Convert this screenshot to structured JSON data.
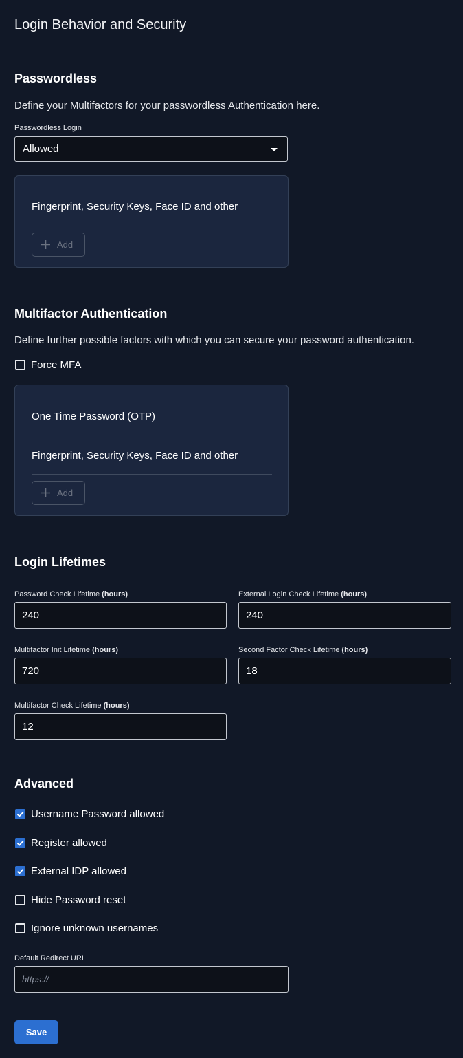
{
  "page": {
    "title": "Login Behavior and Security"
  },
  "passwordless": {
    "title": "Passwordless",
    "description": "Define your Multifactors for your passwordless Authentication here.",
    "select_label": "Passwordless Login",
    "select_value": "Allowed",
    "factors": [
      "Fingerprint, Security Keys, Face ID and other"
    ],
    "add_label": "Add"
  },
  "mfa": {
    "title": "Multifactor Authentication",
    "description": "Define further possible factors with which you can secure your password authentication.",
    "force_mfa_label": "Force MFA",
    "force_mfa_checked": false,
    "factors": [
      "One Time Password (OTP)",
      "Fingerprint, Security Keys, Face ID and other"
    ],
    "add_label": "Add"
  },
  "lifetimes": {
    "title": "Login Lifetimes",
    "unit": "(hours)",
    "fields": [
      {
        "label": "Password Check Lifetime",
        "value": "240"
      },
      {
        "label": "External Login Check Lifetime",
        "value": "240"
      },
      {
        "label": "Multifactor Init Lifetime",
        "value": "720"
      },
      {
        "label": "Second Factor Check Lifetime",
        "value": "18"
      },
      {
        "label": "Multifactor Check Lifetime",
        "value": "12"
      }
    ]
  },
  "advanced": {
    "title": "Advanced",
    "options": [
      {
        "label": "Username Password allowed",
        "checked": true
      },
      {
        "label": "Register allowed",
        "checked": true
      },
      {
        "label": "External IDP allowed",
        "checked": true
      },
      {
        "label": "Hide Password reset",
        "checked": false
      },
      {
        "label": "Ignore unknown usernames",
        "checked": false
      }
    ],
    "redirect_label": "Default Redirect URI",
    "redirect_placeholder": "https://",
    "redirect_value": ""
  },
  "actions": {
    "save_label": "Save"
  },
  "colors": {
    "background": "#111827",
    "card": "#1b263e",
    "accent": "#2c6fd1",
    "input_background": "#0d1119"
  }
}
